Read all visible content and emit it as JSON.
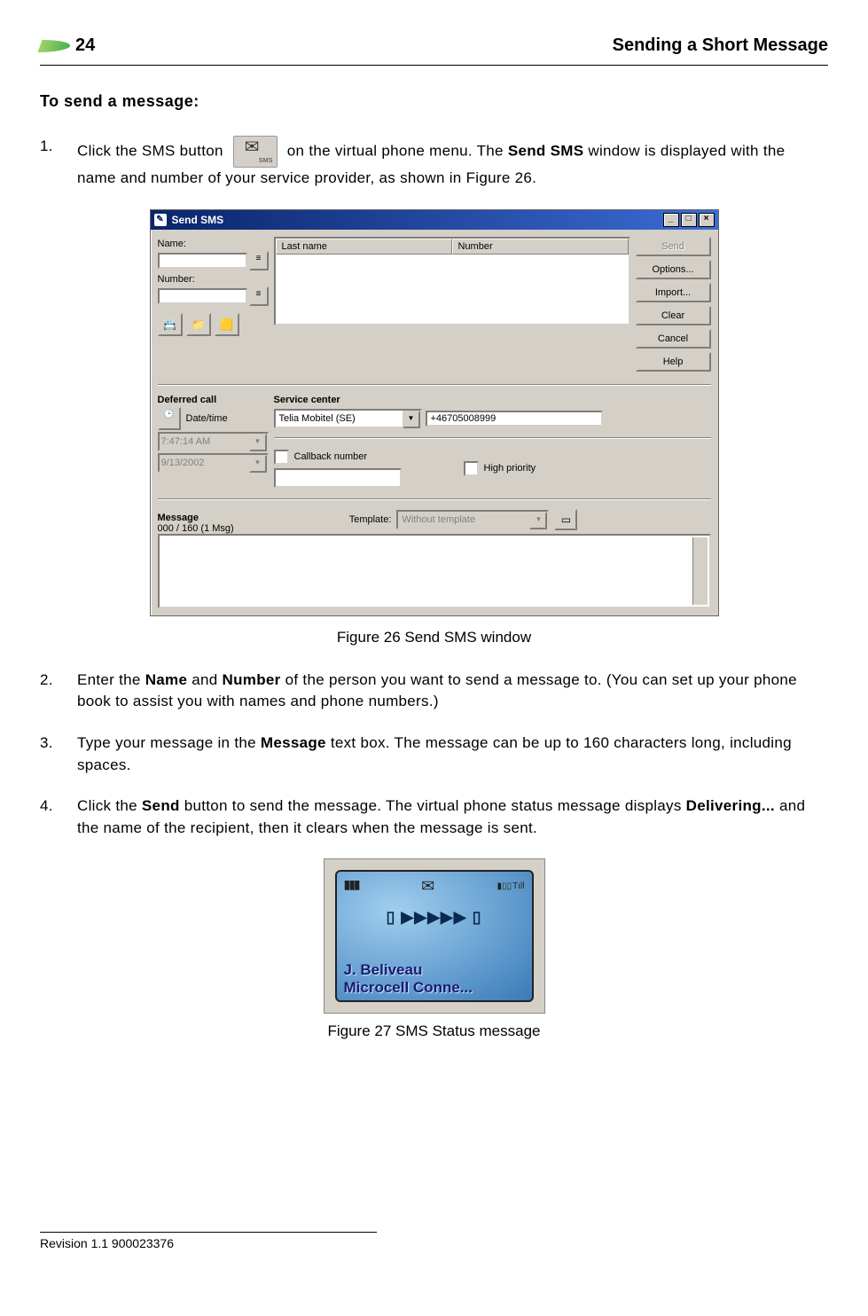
{
  "header": {
    "page_number": "24",
    "title": "Sending a Short Message"
  },
  "section_heading": "To send a message:",
  "steps": {
    "s1_num": "1.",
    "s1_a": "Click the SMS button ",
    "s1_b": " on the virtual phone menu. The ",
    "s1_bold1": "Send SMS",
    "s1_c": " window is displayed with the name and number of your service provider, as shown in Figure 26.",
    "s2_num": "2.",
    "s2_a": "Enter the ",
    "s2_b1": "Name",
    "s2_b": " and ",
    "s2_b2": "Number",
    "s2_c": " of the person you want to send a message to. (You can set up your phone book to assist you with names and phone numbers.)",
    "s3_num": "3.",
    "s3_a": "Type your message in the ",
    "s3_b1": "Message",
    "s3_b": " text box. The message can be up to 160 characters long, including spaces.",
    "s4_num": "4.",
    "s4_a": "Click the ",
    "s4_b1": "Send",
    "s4_b": " button to send the message. The virtual phone status message displays ",
    "s4_b2": "Delivering...",
    "s4_c": " and the name of the recipient, then it clears when the message is sent."
  },
  "figure26_caption": "Figure 26 Send SMS window",
  "figure27_caption": "Figure 27 SMS Status message",
  "win": {
    "title": "Send SMS",
    "name_label": "Name:",
    "number_label": "Number:",
    "list_col1": "Last name",
    "list_col2": "Number",
    "btn_send": "Send",
    "btn_options": "Options...",
    "btn_import": "Import...",
    "btn_clear": "Clear",
    "btn_cancel": "Cancel",
    "btn_help": "Help",
    "deferred_label": "Deferred call",
    "datetime_label": "Date/time",
    "time_value": "7:47:14 AM",
    "date_value": "9/13/2002",
    "sc_label": "Service center",
    "sc_value": "Telia Mobitel (SE)",
    "sc_number": "+46705008999",
    "cb_callback": "Callback number",
    "cb_priority": "High priority",
    "msg_label": "Message",
    "msg_count": "000 / 160 (1 Msg)",
    "tmpl_label": "Template:",
    "tmpl_value": "Without template"
  },
  "phone": {
    "name": "J. Beliveau",
    "conn": "Microcell Conne..."
  },
  "footer": {
    "revision": "Revision 1.1 900023376"
  }
}
